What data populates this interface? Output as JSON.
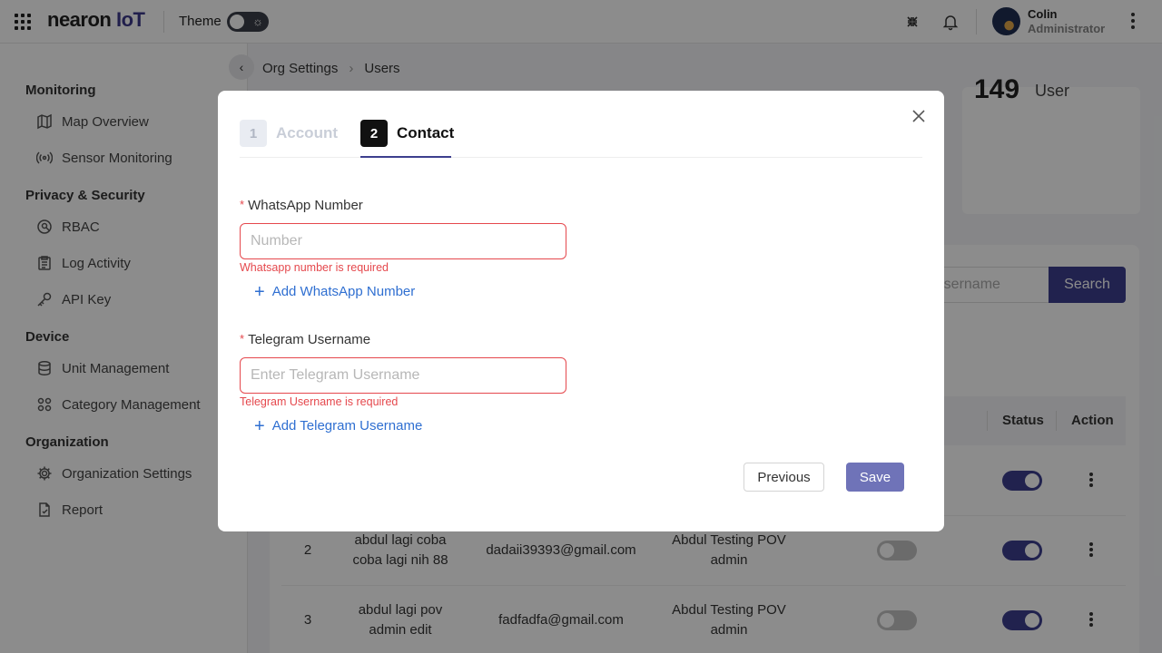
{
  "header": {
    "logo_text": "nearon",
    "logo_suffix": "IoT",
    "theme_label": "Theme",
    "user_name": "Colin",
    "user_role": "Administrator"
  },
  "sidebar": {
    "sections": [
      {
        "title": "Monitoring",
        "items": [
          "Map Overview",
          "Sensor Monitoring"
        ]
      },
      {
        "title": "Privacy & Security",
        "items": [
          "RBAC",
          "Log Activity",
          "API Key"
        ]
      },
      {
        "title": "Device",
        "items": [
          "Unit Management",
          "Category Management"
        ]
      },
      {
        "title": "Organization",
        "items": [
          "Organization Settings",
          "Report"
        ]
      }
    ]
  },
  "breadcrumb": [
    "Org Settings",
    "Users"
  ],
  "stats": {
    "number": "149",
    "label": "User"
  },
  "search": {
    "placeholder": "r username",
    "button": "Search"
  },
  "table": {
    "headers": [
      "Status",
      "Action"
    ],
    "rows": [
      {
        "no": "2",
        "name": "abdul lagi coba coba lagi nih 88",
        "email": "dadaii39393@gmail.com",
        "org": "Abdul Testing POV admin",
        "toggle1": false,
        "status": true
      },
      {
        "no": "3",
        "name": "abdul lagi pov admin edit",
        "email": "fadfadfa@gmail.com",
        "org": "Abdul Testing POV admin",
        "toggle1": false,
        "status": true
      }
    ]
  },
  "modal": {
    "steps": [
      {
        "num": "1",
        "label": "Account",
        "active": false
      },
      {
        "num": "2",
        "label": "Contact",
        "active": true
      }
    ],
    "whatsapp": {
      "label": "WhatsApp Number",
      "placeholder": "Number",
      "value": "",
      "error": "Whatsapp number is required",
      "add_link": "Add WhatsApp Number"
    },
    "telegram": {
      "label": "Telegram Username",
      "placeholder": "Enter Telegram Username",
      "value": "",
      "error": "Telegram Username is required",
      "add_link": "Add Telegram Username"
    },
    "previous_label": "Previous",
    "save_label": "Save"
  },
  "colors": {
    "accent": "#3d3f8e",
    "error": "#e5484d",
    "link": "#2f6fd1",
    "save": "#6f73b8"
  }
}
